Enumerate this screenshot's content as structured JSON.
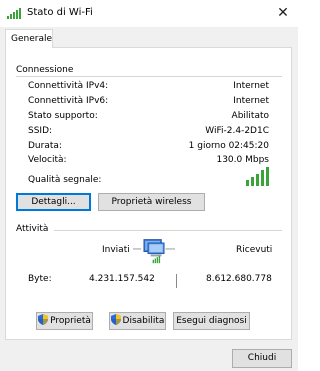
{
  "window": {
    "title": "Stato di Wi-Fi",
    "close_symbol": "✕"
  },
  "tabs": [
    {
      "label": "Generale",
      "active": true
    }
  ],
  "connection": {
    "title": "Connessione",
    "rows": [
      {
        "label": "Connettività IPv4:",
        "value": "Internet"
      },
      {
        "label": "Connettività IPv6:",
        "value": "Internet"
      },
      {
        "label": "Stato supporto:",
        "value": "Abilitato"
      },
      {
        "label": "SSID:",
        "value": "WiFi-2.4-2D1C"
      },
      {
        "label": "Durata:",
        "value": "1 giorno 02:45:20"
      },
      {
        "label": "Velocità:",
        "value": "130.0 Mbps"
      }
    ],
    "signal_label": "Qualità segnale:",
    "signal_bars": 5,
    "signal_max": 5,
    "details_button": "Dettagli...",
    "wireless_props_button": "Proprietà wireless"
  },
  "activity": {
    "title": "Attività",
    "sent_label": "Inviati",
    "received_label": "Ricevuti",
    "bytes_label": "Byte:",
    "bytes_sent": "4.231.157.542",
    "bytes_received": "8.612.680.778"
  },
  "actions": {
    "properties_button": "Proprietà",
    "disable_button": "Disabilita",
    "diagnose_button": "Esegui diagnosi"
  },
  "footer": {
    "close_button": "Chiudi"
  },
  "colors": {
    "signal_green": "#3aa33a",
    "focus_blue": "#0078d7",
    "button_face": "#e1e1e1",
    "panel_bg": "#ffffff",
    "window_bg": "#f0f0f0"
  }
}
